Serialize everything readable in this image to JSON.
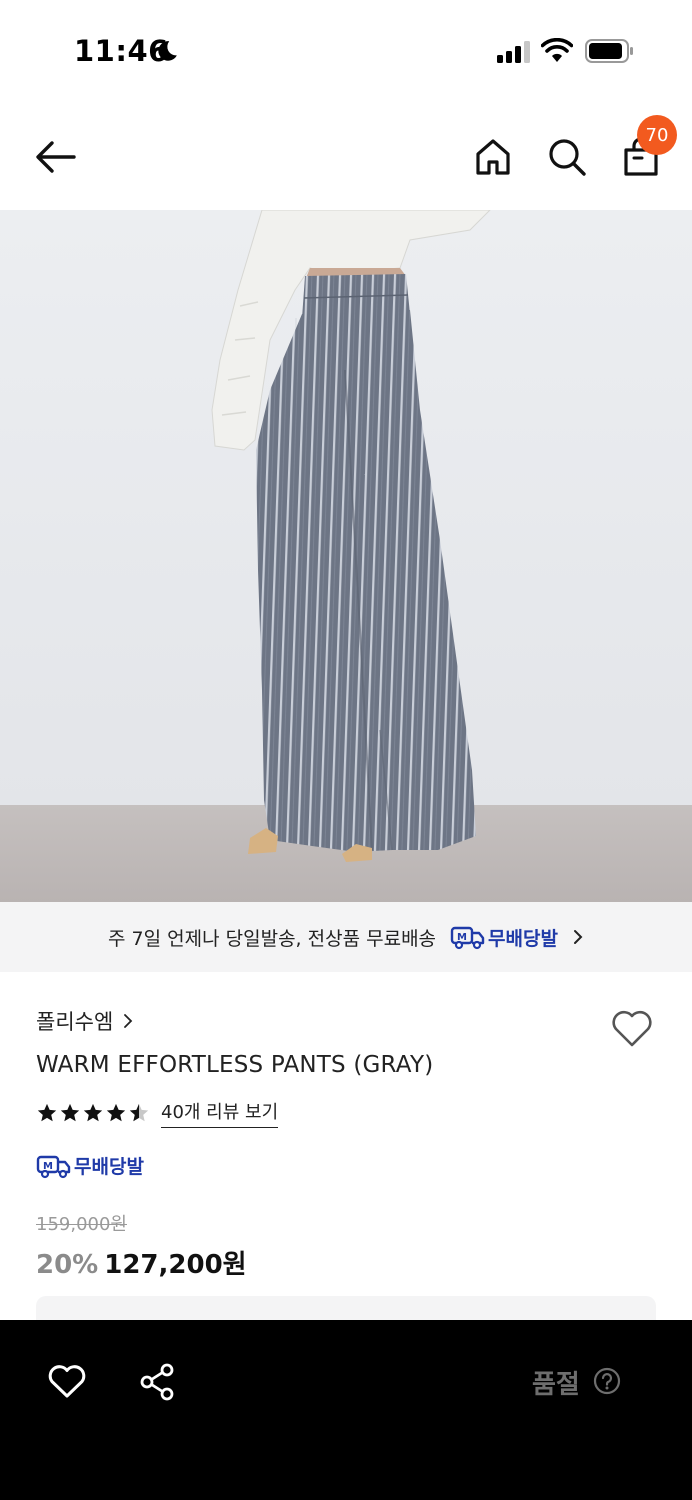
{
  "status_bar": {
    "time": "11:46",
    "icons": [
      "moon-icon",
      "signal-icon",
      "wifi-icon",
      "battery-icon"
    ]
  },
  "nav": {
    "icons": [
      "arrow-left-icon",
      "home-icon",
      "search-icon",
      "shopping-bag-icon"
    ],
    "cart_count": "70"
  },
  "banner": {
    "text": "주 7일 언제나 당일발송, 전상품 무료배송",
    "brand": "무배당발"
  },
  "product": {
    "brand": "폴리수엠",
    "name": "WARM EFFORTLESS PANTS (GRAY)",
    "rating": 4.5,
    "rating_max": 5,
    "review_link": "40개 리뷰 보기",
    "delivery_tag": "무배당발",
    "original_price": "159,000원",
    "discount_rate": "20%",
    "sale_price": "127,200원"
  },
  "bottom_bar": {
    "status_label": "품절"
  },
  "colors": {
    "accent_blue": "#1f3aa8",
    "badge_orange": "#f25a1f",
    "bottom_bar_bg": "#000000"
  }
}
